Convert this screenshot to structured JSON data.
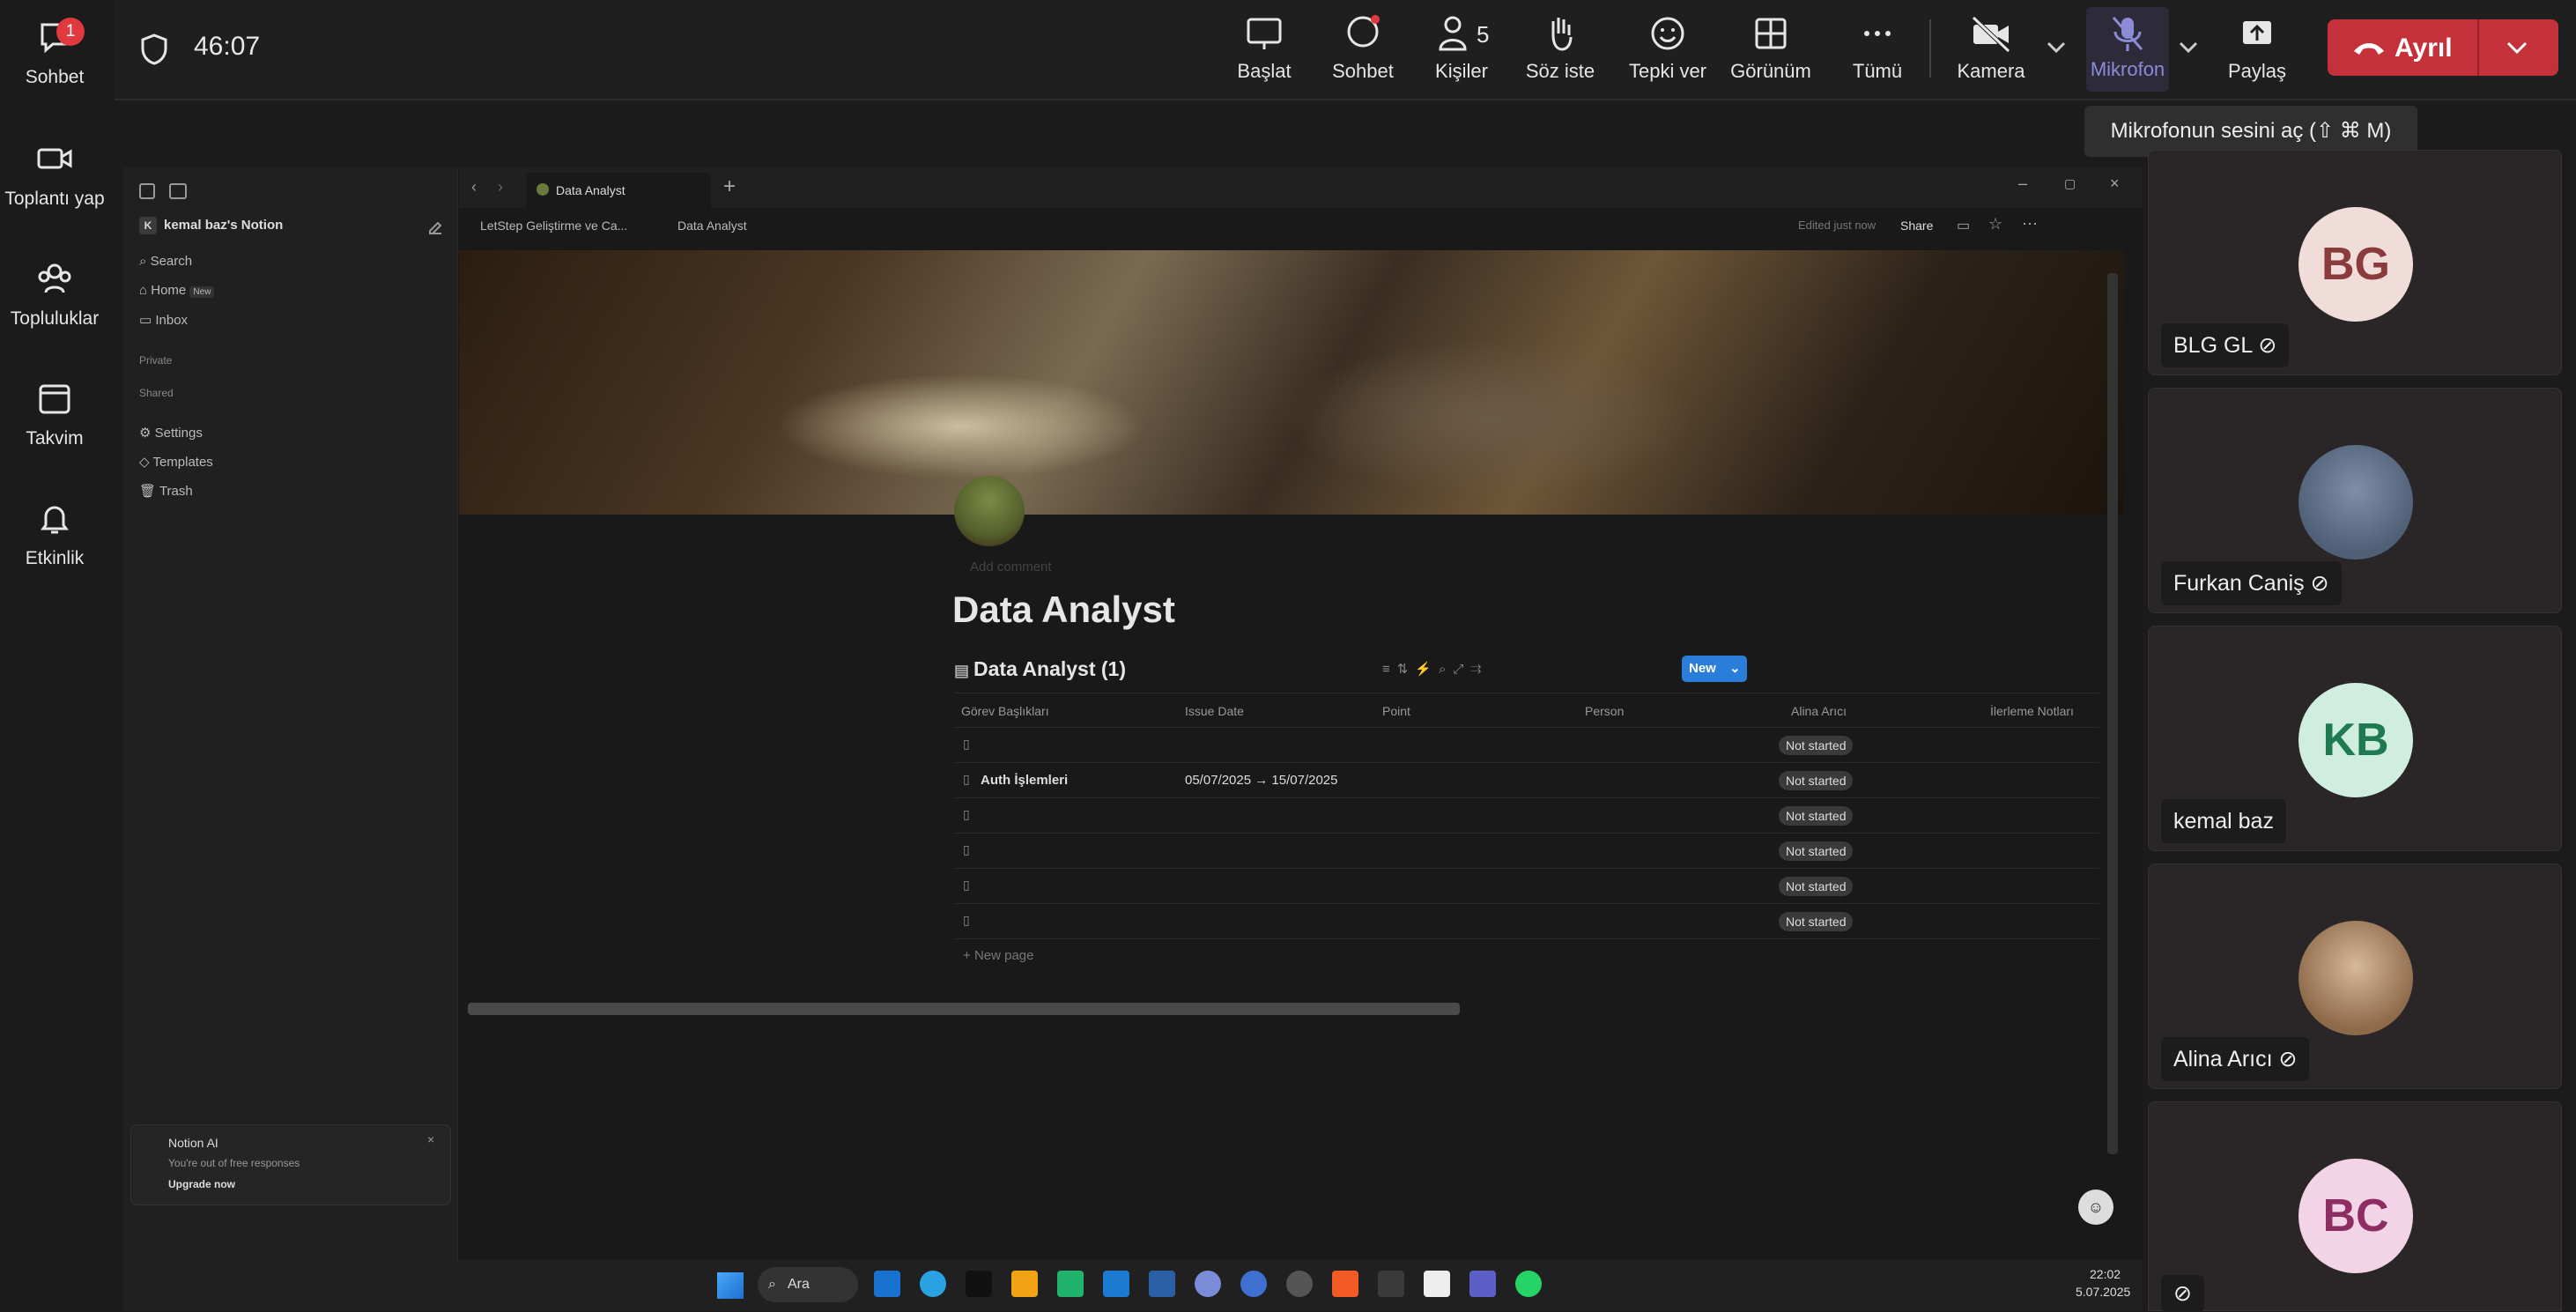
{
  "rail": {
    "items": [
      {
        "label": "Sohbet",
        "badge": "1"
      },
      {
        "label": "Toplantı yap"
      },
      {
        "label": "Topluluklar"
      },
      {
        "label": "Takvim"
      },
      {
        "label": "Etkinlik"
      }
    ]
  },
  "topbar": {
    "timer": "46:07",
    "items": [
      {
        "label": "Başlat"
      },
      {
        "label": "Sohbet"
      },
      {
        "label": "Kişiler",
        "count": "5"
      },
      {
        "label": "Söz iste"
      },
      {
        "label": "Tepki ver"
      },
      {
        "label": "Görünüm"
      },
      {
        "label": "Tümü"
      },
      {
        "label": "Kamera"
      },
      {
        "label": "Mikrofon"
      },
      {
        "label": "Paylaş"
      }
    ],
    "leave_label": "Ayrıl",
    "tooltip": "Mikrofonun sesini aç (⇧ ⌘ M)"
  },
  "notion": {
    "tab_title": "Data Analyst",
    "breadcrumb": [
      "LetStep Geliştirme ve Ca...",
      "Data Analyst"
    ],
    "edited": "Edited just now",
    "share": "Share",
    "workspace": "kemal baz's Notion",
    "sidebar": {
      "search": "Search",
      "home": "Home",
      "home_badge": "New",
      "inbox": "Inbox",
      "private": "Private",
      "shared": "Shared",
      "settings": "Settings",
      "templates": "Templates",
      "trash": "Trash"
    },
    "ai": {
      "title": "Notion AI",
      "desc": "You're out of free responses",
      "cta": "Upgrade now"
    },
    "page_title": "Data Analyst",
    "add_comment": "Add comment",
    "db": {
      "title": "Data Analyst (1)",
      "new_label": "New",
      "columns": [
        "Görev Başlıkları",
        "Issue Date",
        "Point",
        "Person",
        "Alina Arıcı",
        "İlerleme Notları"
      ],
      "rows": [
        {
          "title": "",
          "date": "",
          "status": "Not started"
        },
        {
          "title": "Auth İşlemleri",
          "date": "05/07/2025 → 15/07/2025",
          "status": "Not started"
        },
        {
          "title": "",
          "date": "",
          "status": "Not started"
        },
        {
          "title": "",
          "date": "",
          "status": "Not started"
        },
        {
          "title": "",
          "date": "",
          "status": "Not started"
        },
        {
          "title": "",
          "date": "",
          "status": "Not started"
        }
      ],
      "new_page": "New page"
    }
  },
  "taskbar": {
    "search": "Ara",
    "time": "22:02",
    "date": "5.07.2025"
  },
  "participants": [
    {
      "initials": "BG",
      "name": "BLG GL",
      "bg": "#f0dcd9",
      "fg": "#8a3b3b"
    },
    {
      "initials": "",
      "name": "Furkan Caniş",
      "bg": "#5b6f86",
      "fg": "#fff"
    },
    {
      "initials": "KB",
      "name": "kemal baz",
      "bg": "#cfeee0",
      "fg": "#1f7a52"
    },
    {
      "initials": "",
      "name": "Alina Arıcı",
      "bg": "#b99a7a",
      "fg": "#fff"
    },
    {
      "initials": "BC",
      "name": "",
      "bg": "#f3d4e6",
      "fg": "#8d2d63"
    }
  ]
}
